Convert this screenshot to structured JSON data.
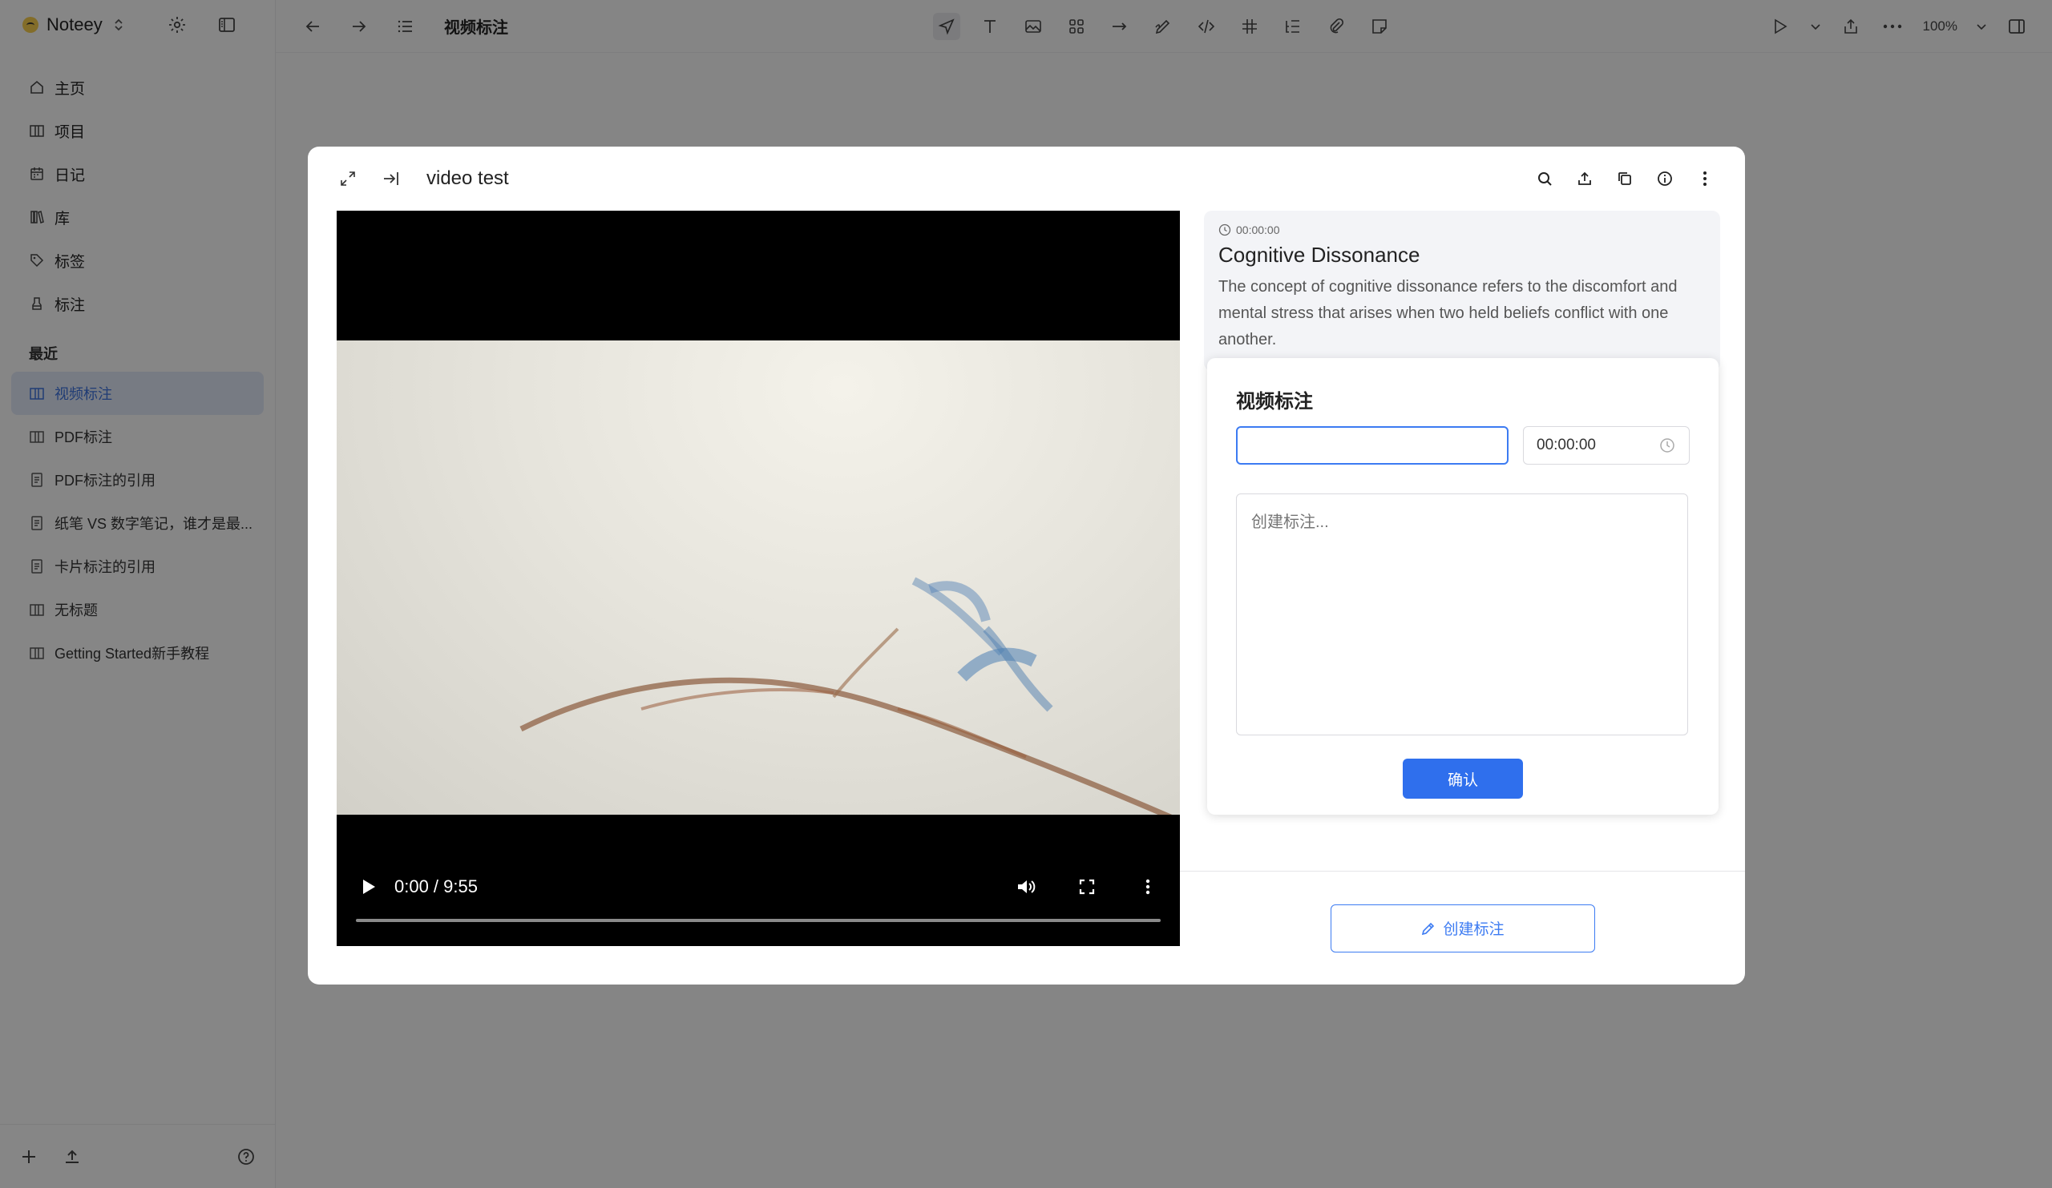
{
  "app": {
    "name": "Noteey",
    "updown_icon": "chevron-updown-icon"
  },
  "nav": [
    {
      "label": "主页",
      "icon": "home-icon"
    },
    {
      "label": "项目",
      "icon": "book-open-icon"
    },
    {
      "label": "日记",
      "icon": "calendar-icon"
    },
    {
      "label": "库",
      "icon": "library-icon"
    },
    {
      "label": "标签",
      "icon": "tag-icon"
    },
    {
      "label": "标注",
      "icon": "highlighter-icon"
    }
  ],
  "recent": {
    "title": "最近",
    "items": [
      {
        "label": "视频标注",
        "icon": "book-open-icon",
        "active": true
      },
      {
        "label": "PDF标注",
        "icon": "book-open-icon",
        "active": false
      },
      {
        "label": "PDF标注的引用",
        "icon": "document-icon",
        "active": false
      },
      {
        "label": "纸笔 VS 数字笔记，谁才是最...",
        "icon": "document-icon",
        "active": false
      },
      {
        "label": "卡片标注的引用",
        "icon": "document-icon",
        "active": false
      },
      {
        "label": "无标题",
        "icon": "book-open-icon",
        "active": false
      },
      {
        "label": "Getting Started新手教程",
        "icon": "book-open-icon",
        "active": false
      }
    ]
  },
  "topbar": {
    "doc_title": "视频标注",
    "zoom": "100%"
  },
  "modal": {
    "title": "video test",
    "video": {
      "time": "0:00 / 9:55",
      "progress": 0
    },
    "note": {
      "timestamp": "00:00:00",
      "title": "Cognitive Dissonance",
      "description": "The concept of cognitive dissonance refers to the discomfort and mental stress that arises when two held beliefs conflict with one another."
    },
    "form": {
      "title": "视频标注",
      "title_value": "",
      "time_value": "00:00:00",
      "content_placeholder": "创建标注...",
      "confirm_label": "确认"
    },
    "create_label": "创建标注"
  },
  "colors": {
    "accent": "#2f6fed",
    "active_bg": "#dde4f3"
  }
}
